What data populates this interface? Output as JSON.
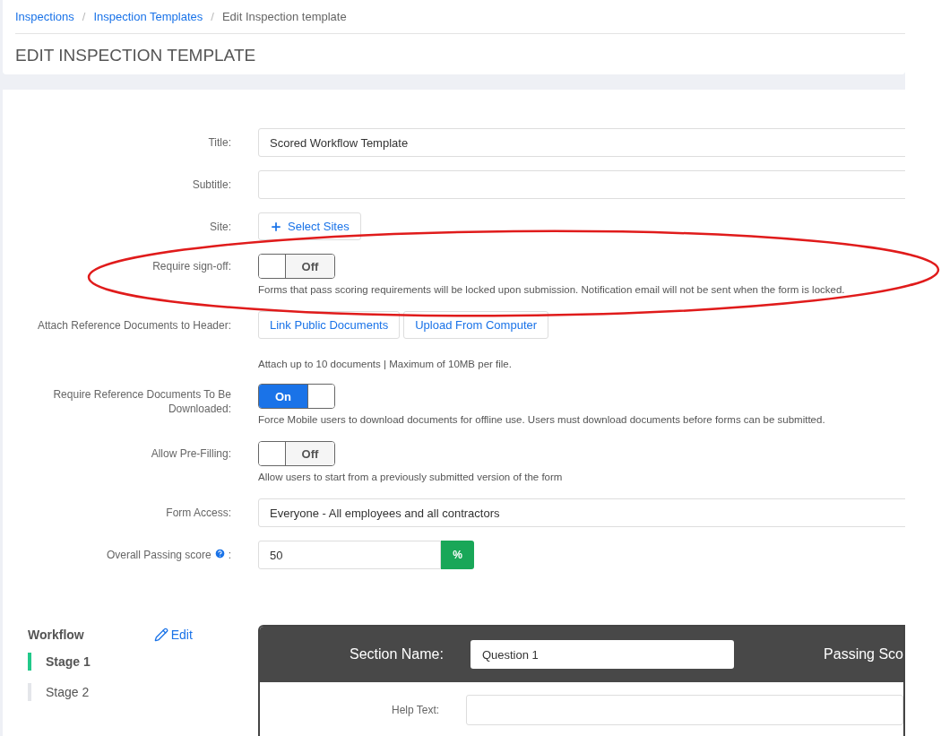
{
  "breadcrumb": [
    {
      "label": "Inspections",
      "current": false
    },
    {
      "label": "Inspection Templates",
      "current": false
    },
    {
      "label": "Edit Inspection template",
      "current": true
    }
  ],
  "separator": "/",
  "heading": "EDIT INSPECTION TEMPLATE",
  "fields": [
    {
      "kind": "text",
      "label": "Title:",
      "value": "Scored Workflow Template"
    },
    {
      "kind": "text",
      "label": "Subtitle:"
    },
    {
      "kind": "site",
      "label": "Site:",
      "button": "Select Sites"
    },
    {
      "kind": "toggle",
      "label": "Require sign-off:",
      "on": false,
      "state_label": "Off",
      "help": "Forms that pass scoring requirements will be locked upon submission. Notification email will not be sent when the form is locked."
    },
    {
      "kind": "attach",
      "label": "Attach Reference Documents to Header:",
      "buttons": [
        "Link Public Documents",
        "Upload From Computer"
      ],
      "note": "Attach up to 10 documents | Maximum of 10MB per file."
    },
    {
      "kind": "toggle",
      "label": "Require Reference Documents To Be Downloaded:",
      "on": true,
      "state_label": "On",
      "help": "Force Mobile users to download documents for offline use. Users must download documents before forms can be submitted."
    },
    {
      "kind": "toggle",
      "label": "Allow Pre-Filling:",
      "on": false,
      "state_label": "Off",
      "help": "Allow users to start from a previously submitted version of the form"
    },
    {
      "kind": "select",
      "label": "Form Access:",
      "value": "Everyone - All employees and all contractors"
    },
    {
      "kind": "score",
      "label": "Overall Passing score",
      "colon": ":",
      "value": "50",
      "unit": "%"
    }
  ],
  "workflow": {
    "title": "Workflow",
    "edit": "Edit",
    "stages": [
      {
        "label": "Stage 1",
        "selected": true
      },
      {
        "label": "Stage 2",
        "selected": false
      }
    ],
    "section": {
      "name_label": "Section Name:",
      "name_value": "Question 1",
      "passing_label": "Passing Sco",
      "help_label": "Help Text:"
    }
  }
}
